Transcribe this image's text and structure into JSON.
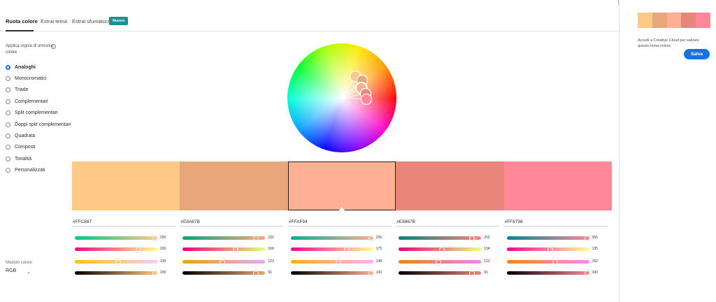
{
  "tabs": [
    {
      "label": "Ruota colore",
      "active": true
    },
    {
      "label": "Estrai tema",
      "active": false
    },
    {
      "label": "Estrai sfumatura",
      "active": false
    }
  ],
  "new_badge": "Nuovo",
  "harmony": {
    "label": "Applica regola di armonia colore",
    "info_icon": "info-icon",
    "options": [
      {
        "label": "Analoghi",
        "checked": true
      },
      {
        "label": "Monocromatici",
        "checked": false
      },
      {
        "label": "Triade",
        "checked": false
      },
      {
        "label": "Complementari",
        "checked": false
      },
      {
        "label": "Split complementari",
        "checked": false
      },
      {
        "label": "Doppi split complementari",
        "checked": false
      },
      {
        "label": "Quadrata",
        "checked": false
      },
      {
        "label": "Composti",
        "checked": false
      },
      {
        "label": "Tonalità",
        "checked": false
      },
      {
        "label": "Personalizzati",
        "checked": false
      }
    ]
  },
  "color_method": {
    "label": "Metodo colore",
    "value": "RGB",
    "icon": "chevron-down-icon"
  },
  "colors": [
    {
      "hex": "#FFC887",
      "rgb": [
        255,
        200,
        135
      ],
      "sliders": [
        255,
        200,
        135,
        100
      ],
      "selected": false
    },
    {
      "hex": "#E8A67B",
      "rgb": [
        232,
        166,
        123
      ],
      "sliders": [
        232,
        166,
        123,
        91
      ],
      "selected": false
    },
    {
      "hex": "#FFAF94",
      "rgb": [
        255,
        175,
        148
      ],
      "sliders": [
        255,
        175,
        148,
        100
      ],
      "selected": true
    },
    {
      "hex": "#E8867B",
      "rgb": [
        232,
        134,
        123
      ],
      "sliders": [
        232,
        134,
        123,
        91
      ],
      "selected": false
    },
    {
      "hex": "#FF8798",
      "rgb": [
        255,
        135,
        152
      ],
      "sliders": [
        255,
        135,
        152,
        100
      ],
      "selected": false
    }
  ],
  "slider_max": 255,
  "brightness_max": 100,
  "right_panel": {
    "login_text": "Accedi a Creative Cloud per salvare questo tema colore.",
    "save_label": "Salva"
  },
  "accent_color": "#1473e6",
  "badge_color": "#1f8f8f"
}
